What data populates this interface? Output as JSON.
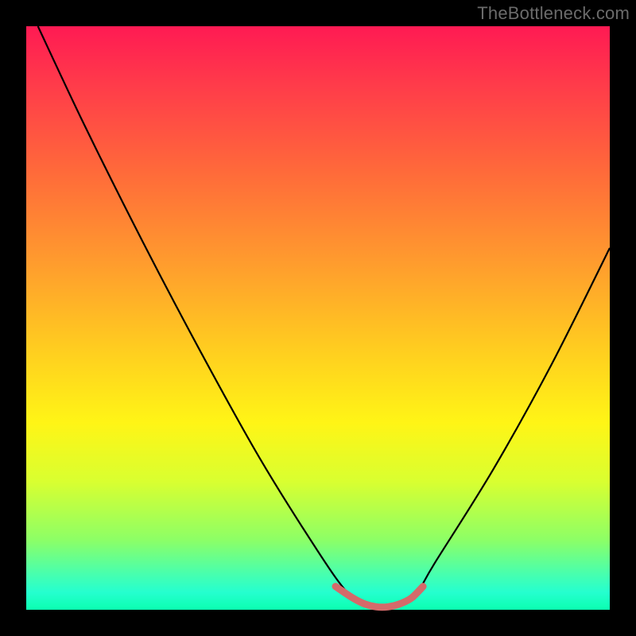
{
  "watermark": "TheBottleneck.com",
  "chart_data": {
    "type": "line",
    "title": "",
    "xlabel": "",
    "ylabel": "",
    "xlim": [
      0,
      100
    ],
    "ylim": [
      0,
      100
    ],
    "series": [
      {
        "name": "main-curve",
        "color": "#000000",
        "x": [
          2,
          10,
          20,
          30,
          40,
          50,
          55,
          58,
          61,
          64,
          67,
          70,
          80,
          90,
          100
        ],
        "y": [
          100,
          83,
          63,
          44,
          26,
          10,
          3,
          1,
          0.5,
          1,
          3,
          8,
          24,
          42,
          62
        ]
      },
      {
        "name": "highlight-band",
        "color": "#d46a6a",
        "x": [
          53,
          56,
          58,
          60,
          62,
          64,
          66,
          68
        ],
        "y": [
          4,
          2,
          1,
          0.5,
          0.5,
          1,
          2,
          4
        ]
      }
    ],
    "gradient_stops": [
      {
        "offset": 0,
        "color": "#ff1a53"
      },
      {
        "offset": 10,
        "color": "#ff3b4a"
      },
      {
        "offset": 25,
        "color": "#ff6a3a"
      },
      {
        "offset": 40,
        "color": "#ff9a2e"
      },
      {
        "offset": 55,
        "color": "#ffcc20"
      },
      {
        "offset": 68,
        "color": "#fff516"
      },
      {
        "offset": 78,
        "color": "#d9ff30"
      },
      {
        "offset": 88,
        "color": "#8dff66"
      },
      {
        "offset": 94,
        "color": "#46ffb0"
      },
      {
        "offset": 97,
        "color": "#25ffcf"
      },
      {
        "offset": 100,
        "color": "#0bffb0"
      }
    ]
  }
}
